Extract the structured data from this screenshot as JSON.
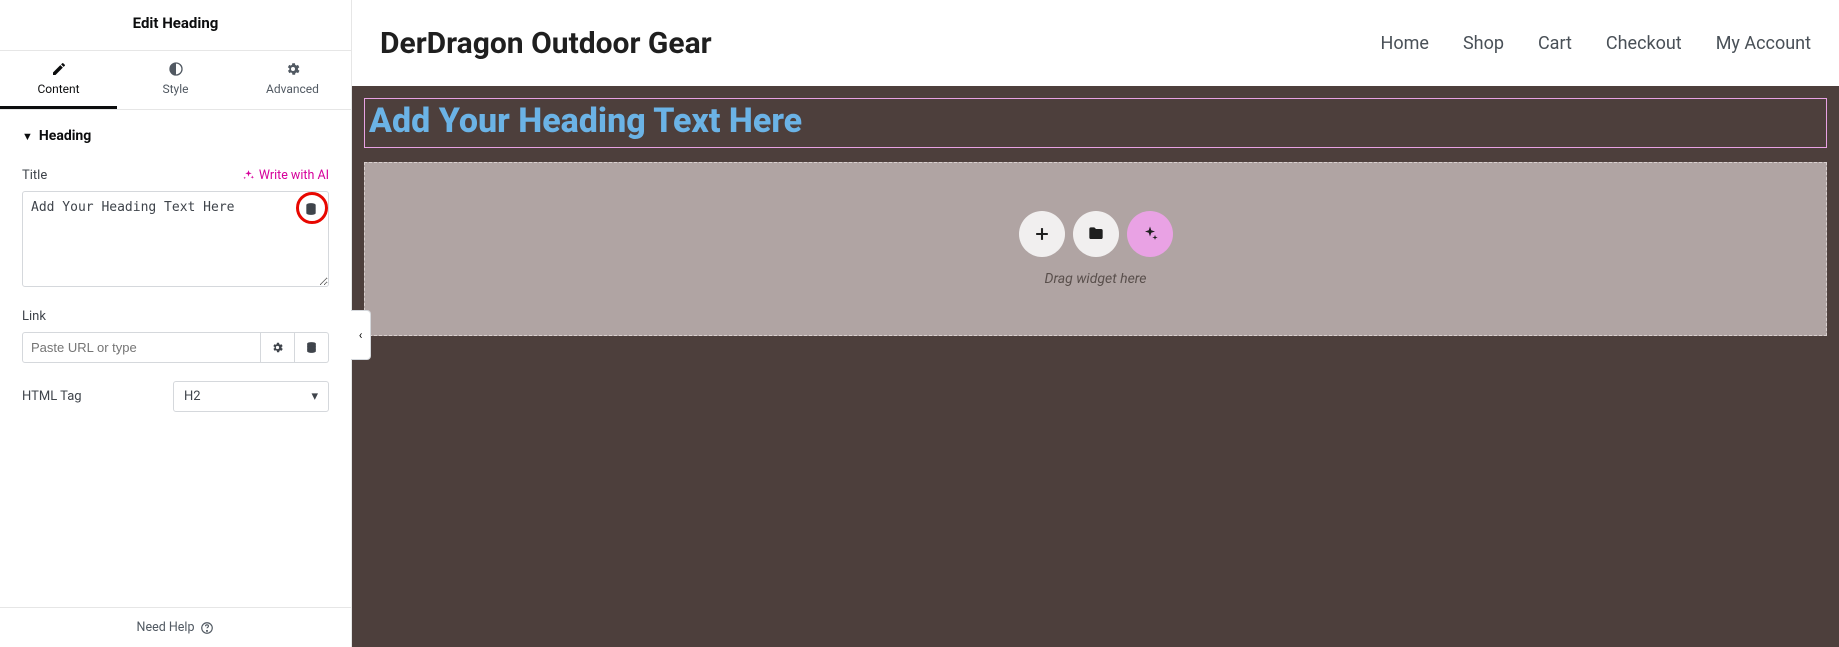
{
  "panel": {
    "title": "Edit Heading",
    "tabs": {
      "content": "Content",
      "style": "Style",
      "advanced": "Advanced"
    },
    "section_head": "Heading",
    "title_field": {
      "label": "Title",
      "ai_label": "Write with AI",
      "value": "Add Your Heading Text Here"
    },
    "link_field": {
      "label": "Link",
      "placeholder": "Paste URL or type"
    },
    "htmltag_field": {
      "label": "HTML Tag",
      "value": "H2"
    },
    "footer": {
      "help": "Need Help"
    }
  },
  "site": {
    "title": "DerDragon Outdoor Gear",
    "nav": [
      "Home",
      "Shop",
      "Cart",
      "Checkout",
      "My Account"
    ]
  },
  "canvas": {
    "heading_preview": "Add Your Heading Text Here",
    "drag_label": "Drag widget here"
  }
}
